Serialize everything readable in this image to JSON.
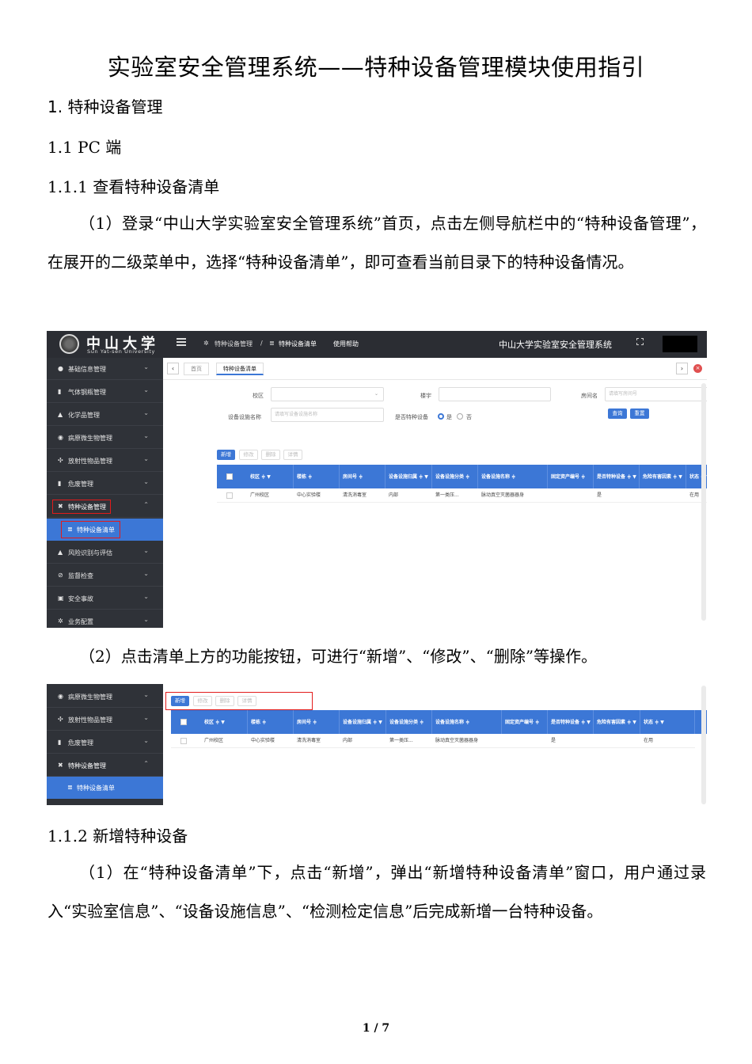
{
  "doc": {
    "title": "实验室安全管理系统——特种设备管理模块使用指引",
    "h1": "1. 特种设备管理",
    "h2": "1.1 PC 端",
    "h3_1": "1.1.1  查看特种设备清单",
    "para1": "（1）登录“中山大学实验室安全管理系统”首页，点击左侧导航栏中的“特种设备管理”，在展开的二级菜单中，选择“特种设备清单”，即可查看当前目录下的特种设备情况。",
    "para2": "（2）点击清单上方的功能按钮，可进行“新增”、“修改”、“删除”等操作。",
    "h3_2": "1.1.2  新增特种设备",
    "para3": "（1）在“特种设备清单”下，点击“新增”，弹出“新增特种设备清单”窗口，用户通过录入“实验室信息”、“设备设施信息”、“检测检定信息”后完成新增一台特种设备。",
    "page_num": "1 / 7"
  },
  "app": {
    "logo_text": "中山大学",
    "logo_sub": "Sun Yat-sen University",
    "breadcrumb": [
      "特种设备管理",
      "/",
      "特种设备清单",
      "使用帮助"
    ],
    "system_name": "中山大学实验室安全管理系统",
    "sidebar": [
      {
        "icon": "●",
        "label": "基础信息管理"
      },
      {
        "icon": "▮",
        "label": "气体钢瓶管理"
      },
      {
        "icon": "▲",
        "label": "化学品管理"
      },
      {
        "icon": "◉",
        "label": "病原微生物管理"
      },
      {
        "icon": "✣",
        "label": "放射性物品管理"
      },
      {
        "icon": "▮",
        "label": "危废管理"
      },
      {
        "icon": "✖",
        "label": "特种设备管理"
      },
      {
        "icon": "▲",
        "label": "风险识别与评估"
      },
      {
        "icon": "⊘",
        "label": "监督检查"
      },
      {
        "icon": "▣",
        "label": "安全事故"
      },
      {
        "icon": "✲",
        "label": "业务配置"
      }
    ],
    "sidebar_sub": {
      "icon": "≣",
      "label": "特种设备清单"
    },
    "tabs": [
      "首页",
      "特种设备清单"
    ],
    "filters": {
      "campus_label": "校区",
      "building_label": "楼宇",
      "room_label": "房间名",
      "room_placeholder": "请填写房间号",
      "device_label": "设备设施名称",
      "device_placeholder": "请填写设备设施名称",
      "special_label": "是否特种设备",
      "yes": "是",
      "no": "否",
      "query": "查询",
      "reset": "重置"
    },
    "toolbar": {
      "add": "新增",
      "edit": "修改",
      "delete": "删除",
      "detail": "详情",
      "icons": "◷ ▼"
    },
    "table": {
      "headers": [
        "校区 ≑ ▼",
        "楼栋 ≑",
        "房间号 ≑",
        "设备设施归属 ≑ ▼",
        "设备设施分类 ≑",
        "设备设施名称 ≑",
        "固定资产编号 ≑",
        "是否特种设备 ≑ ▼",
        "危险有害因素 ≑ ▼",
        "状态 ≑ ▼"
      ],
      "row": [
        "广州校区",
        "中心实验楼",
        "清洗消毒室",
        "内部",
        "第一类压...",
        "脉动真空灭菌器器身",
        "",
        "是",
        "",
        "在用"
      ]
    }
  }
}
